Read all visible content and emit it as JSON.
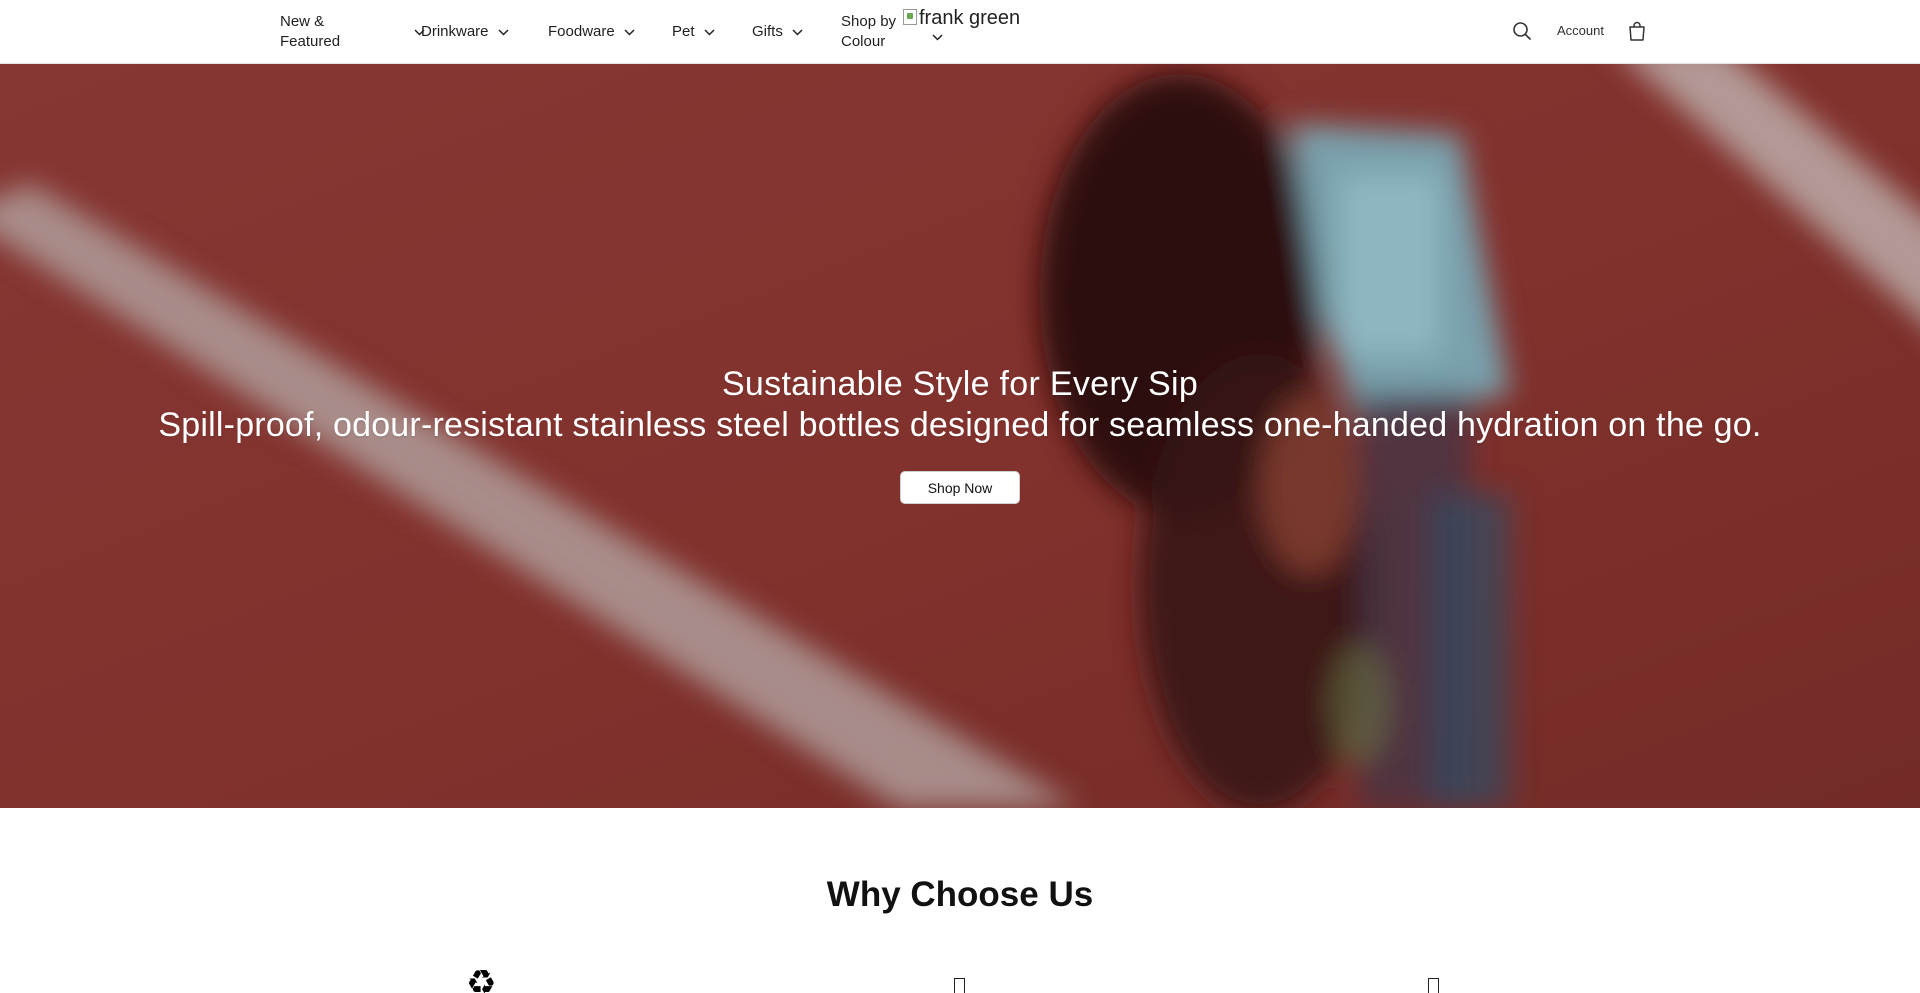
{
  "nav": {
    "items": [
      {
        "label": "New &\nFeatured"
      },
      {
        "label": "Drinkware"
      },
      {
        "label": "Foodware"
      },
      {
        "label": "Pet"
      },
      {
        "label": "Gifts"
      },
      {
        "label": "Shop by\nColour"
      }
    ],
    "logo_alt": "frank green",
    "account_label": "Account",
    "search_icon": "search-icon",
    "bag_icon": "shopping-bag-icon"
  },
  "hero": {
    "title": "Sustainable Style for Every Sip",
    "subtitle": "Spill-proof, odour-resistant stainless steel bottles designed for seamless one-handed hydration on the go.",
    "cta_label": "Shop Now",
    "background_color": "#8a3530"
  },
  "why": {
    "title": "Why Choose Us",
    "features": [
      {
        "icon": "♻"
      },
      {
        "icon": "box-glyph"
      },
      {
        "icon": "box-glyph"
      }
    ]
  }
}
